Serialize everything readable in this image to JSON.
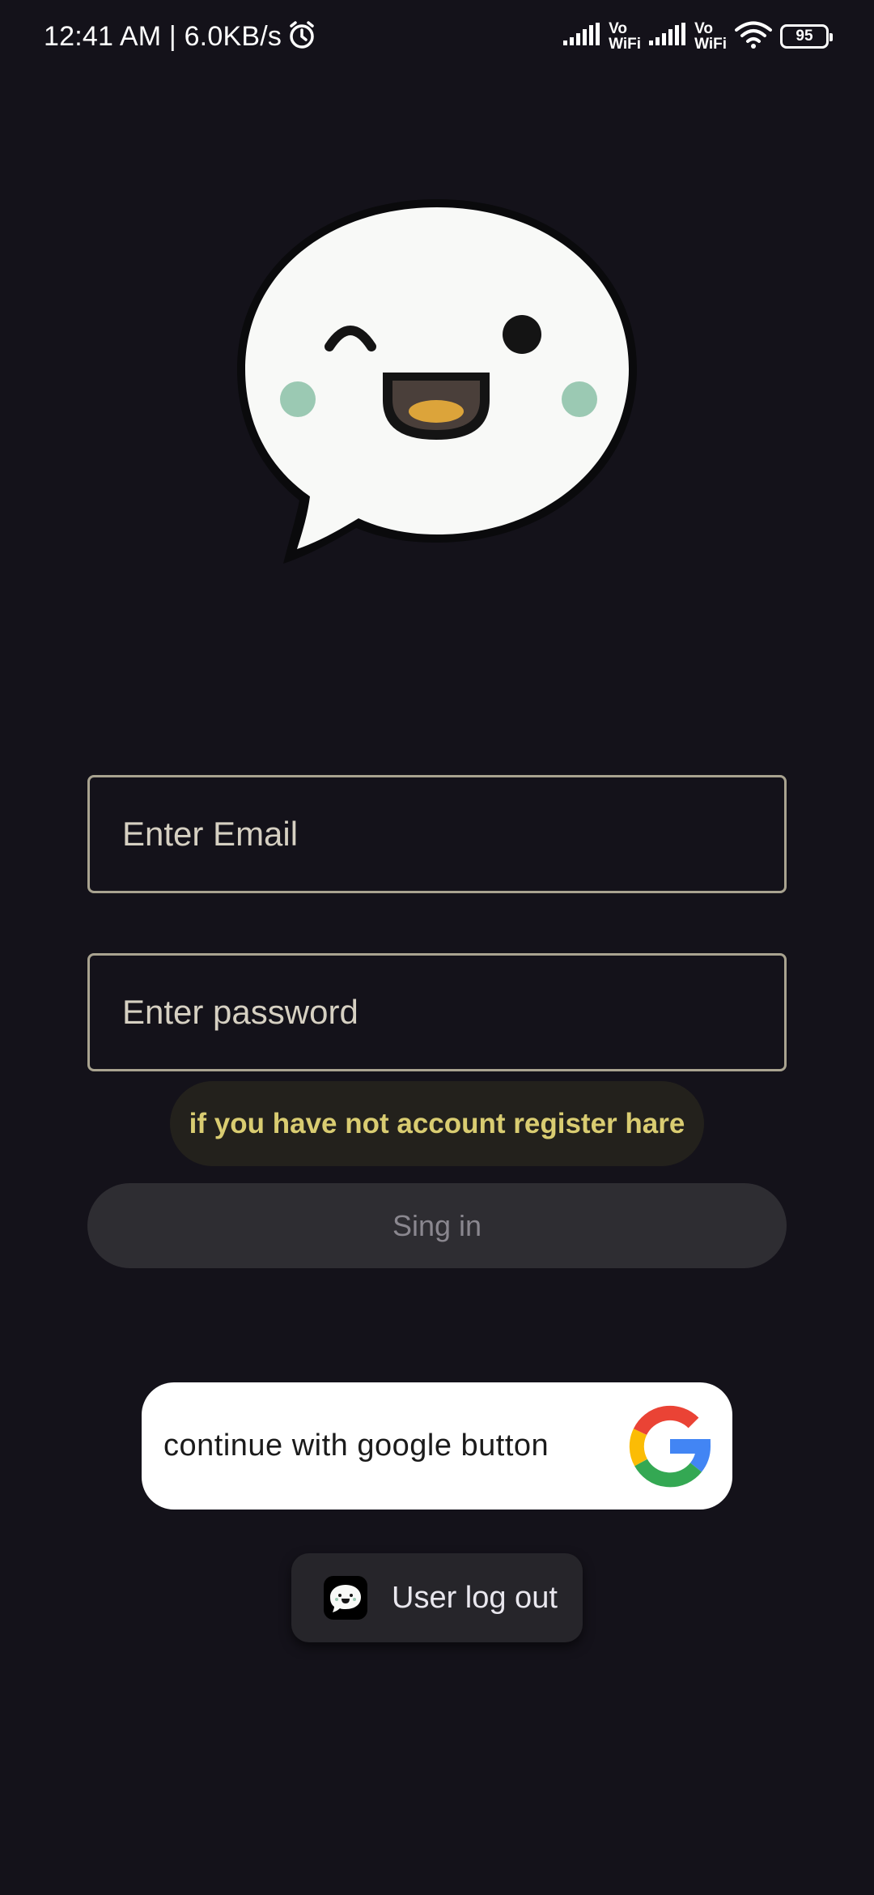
{
  "status_bar": {
    "time": "12:41 AM | 6.0KB/s",
    "vowifi_top": "Vo",
    "vowifi_bottom": "WiFi",
    "battery": "95"
  },
  "login": {
    "email_placeholder": "Enter Email",
    "password_placeholder": "Enter password",
    "register_link": "if you have not account register hare",
    "signin_label": "Sing in",
    "google_label": "continue with google button",
    "logout_label": "User log out"
  },
  "icons": {
    "logo": "smiling-speech-bubble-icon",
    "google": "google-g-icon",
    "logout": "mini-speech-bubble-icon",
    "alarm": "alarm-clock-icon",
    "signal": "signal-bars-icon",
    "wifi": "wifi-icon",
    "battery": "battery-icon"
  },
  "colors": {
    "background": "#14121a",
    "field_border": "#a9a390",
    "register_text": "#d9cc71",
    "signin_bg": "#2e2d32",
    "signin_text": "#8a878f"
  }
}
